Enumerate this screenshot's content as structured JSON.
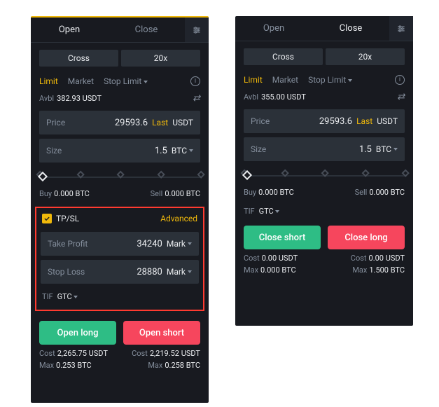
{
  "left": {
    "tabs": {
      "open": "Open",
      "close": "Close"
    },
    "margin_mode": "Cross",
    "leverage": "20x",
    "order_types": {
      "limit": "Limit",
      "market": "Market",
      "stoplimit": "Stop Limit"
    },
    "avbl_label": "Avbl",
    "avbl_value": "382.93 USDT",
    "price": {
      "label": "Price",
      "value": "29593.6",
      "last": "Last",
      "unit": "USDT"
    },
    "size": {
      "label": "Size",
      "value": "1.5",
      "unit": "BTC"
    },
    "buy": {
      "label": "Buy",
      "value": "0.000 BTC"
    },
    "sell": {
      "label": "Sell",
      "value": "0.000 BTC"
    },
    "tpsl": {
      "label": "TP/SL",
      "advanced": "Advanced",
      "tp": {
        "label": "Take Profit",
        "value": "34240",
        "trigger": "Mark"
      },
      "sl": {
        "label": "Stop Loss",
        "value": "28880",
        "trigger": "Mark"
      }
    },
    "tif": {
      "label": "TIF",
      "value": "GTC"
    },
    "buttons": {
      "long": "Open long",
      "short": "Open short"
    },
    "cost_label": "Cost",
    "max_label": "Max",
    "long_cost": "2,265.75 USDT",
    "long_max": "0.253 BTC",
    "short_cost": "2,219.52 USDT",
    "short_max": "0.258 BTC"
  },
  "right": {
    "tabs": {
      "open": "Open",
      "close": "Close"
    },
    "margin_mode": "Cross",
    "leverage": "20x",
    "order_types": {
      "limit": "Limit",
      "market": "Market",
      "stoplimit": "Stop Limit"
    },
    "avbl_label": "Avbl",
    "avbl_value": "355.00 USDT",
    "price": {
      "label": "Price",
      "value": "29593.6",
      "last": "Last",
      "unit": "USDT"
    },
    "size": {
      "label": "Size",
      "value": "1.5",
      "unit": "BTC"
    },
    "buy": {
      "label": "Buy",
      "value": "0.000 BTC"
    },
    "sell": {
      "label": "Sell",
      "value": "0.000 BTC"
    },
    "tif": {
      "label": "TIF",
      "value": "GTC"
    },
    "buttons": {
      "closeshort": "Close short",
      "closelong": "Close long"
    },
    "cost_label": "Cost",
    "max_label": "Max",
    "short_cost": "0.00 USDT",
    "short_max": "0.000 BTC",
    "long_cost": "0.00 USDT",
    "long_max": "1.500 BTC"
  }
}
